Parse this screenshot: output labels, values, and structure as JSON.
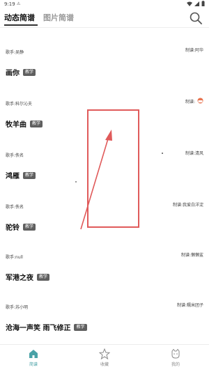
{
  "status": {
    "time": "9:19",
    "sim": "⚠"
  },
  "tabs": {
    "active": "动态简谱",
    "inactive": "图片简谱"
  },
  "items": [
    {
      "singer": "歌手:吴静",
      "maker": "制谱:阿华",
      "title": "画你",
      "badge": "教学"
    },
    {
      "singer": "歌手:科尔沁夫",
      "maker": "制谱:",
      "title": "牧羊曲",
      "badge": "教学"
    },
    {
      "singer": "歌手:佚名",
      "maker": "制谱:清风",
      "title": "鸿雁",
      "badge": "教学"
    },
    {
      "singer": "歌手:佚名",
      "maker": "制谱:我爱白洋淀",
      "title": "驼铃",
      "badge": "教学"
    },
    {
      "singer": "歌手:null",
      "maker": "制谱:懒懒鲨",
      "title": "军港之夜",
      "badge": "教学"
    },
    {
      "singer": "歌手:苏小明",
      "maker": "制谱:糯米团子",
      "title": "沧海一声笑 雨飞修正",
      "badge": "教学"
    }
  ],
  "nav": [
    {
      "label": "简谱",
      "icon": "home-icon"
    },
    {
      "label": "收藏",
      "icon": "star-icon"
    },
    {
      "label": "我的",
      "icon": "cat-icon"
    }
  ],
  "colors": {
    "accent": "#4aa2a7",
    "overlay": "#e05a5a",
    "badge_bg": "#5f5f5f"
  }
}
